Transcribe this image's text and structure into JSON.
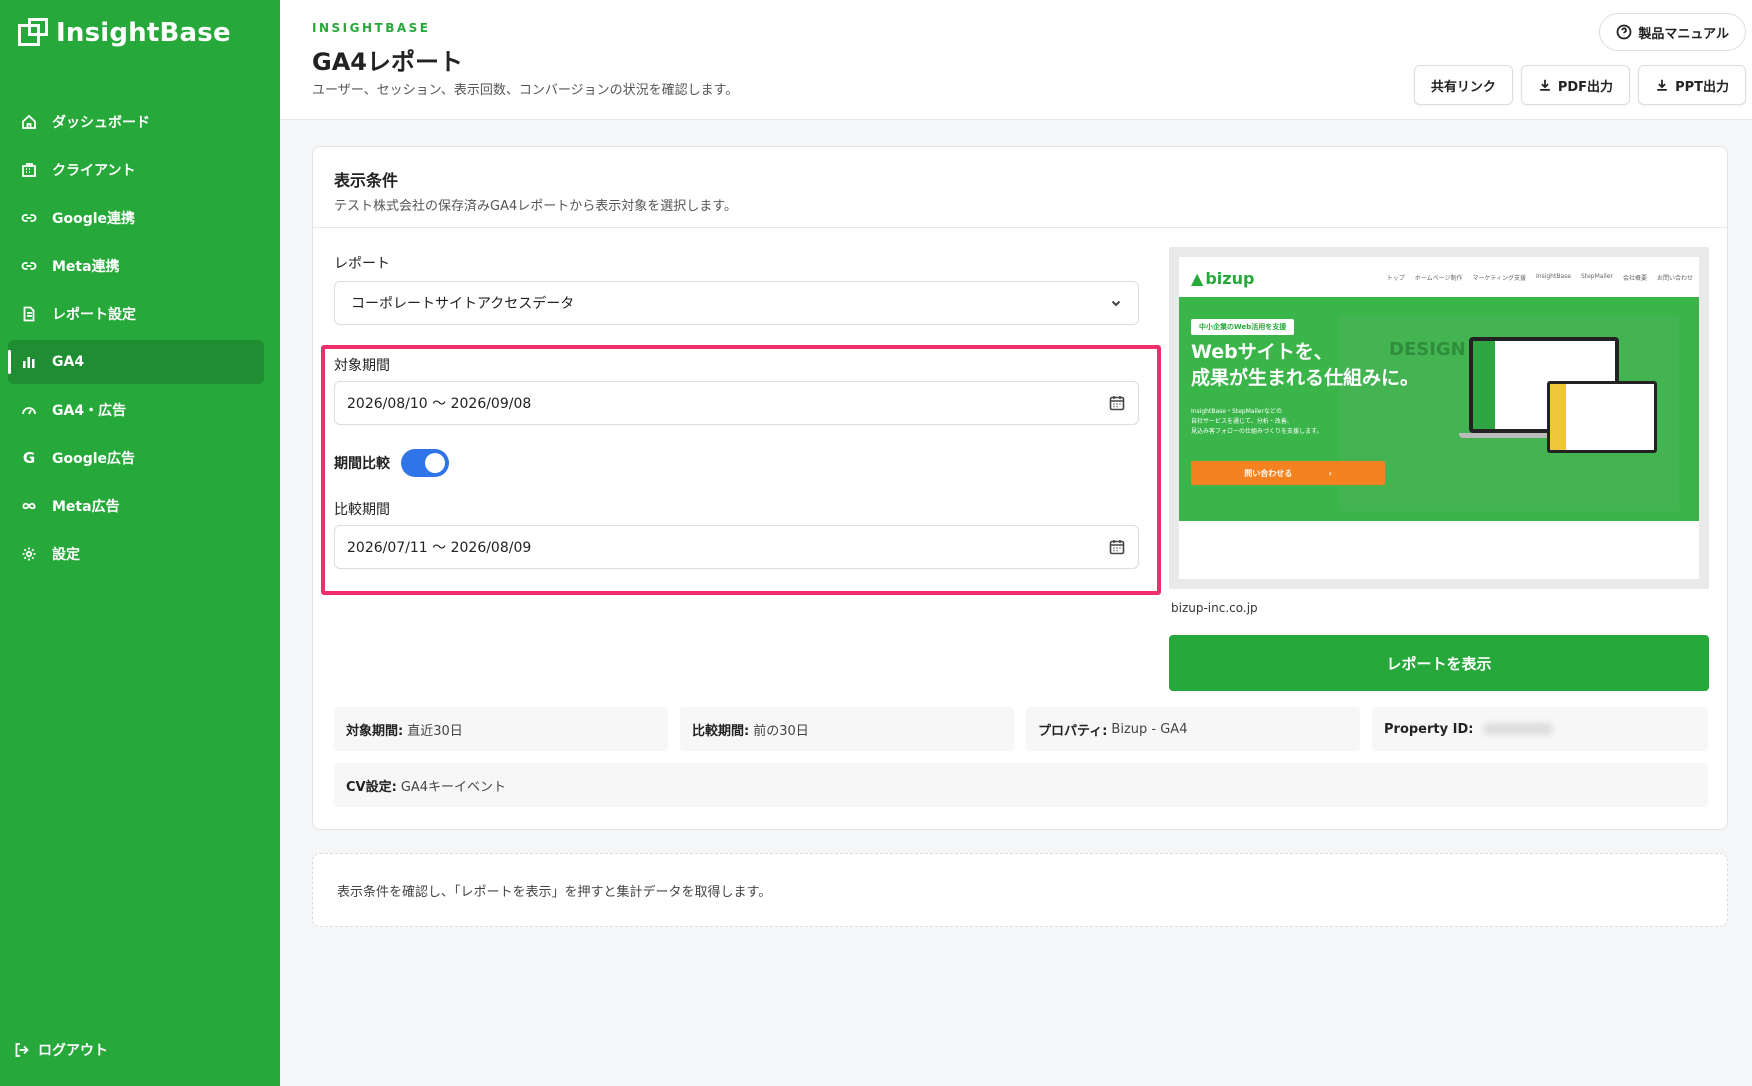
{
  "app": {
    "name": "InsightBase"
  },
  "sidebar": {
    "items": [
      {
        "label": "ダッシュボード",
        "icon": "home-icon"
      },
      {
        "label": "クライアント",
        "icon": "building-icon"
      },
      {
        "label": "Google連携",
        "icon": "link-icon"
      },
      {
        "label": "Meta連携",
        "icon": "link-icon"
      },
      {
        "label": "レポート設定",
        "icon": "document-icon"
      },
      {
        "label": "GA4",
        "icon": "bar-chart-icon",
        "active": true
      },
      {
        "label": "GA4・広告",
        "icon": "gauge-icon"
      },
      {
        "label": "Google広告",
        "icon": "google-icon"
      },
      {
        "label": "Meta広告",
        "icon": "infinity-icon"
      },
      {
        "label": "設定",
        "icon": "gear-icon"
      }
    ],
    "logout_label": "ログアウト"
  },
  "header": {
    "eyebrow": "INSIGHTBASE",
    "title": "GA4レポート",
    "subtitle": "ユーザー、セッション、表示回数、コンバージョンの状況を確認します。",
    "manual_label": "製品マニュアル",
    "share_label": "共有リンク",
    "pdf_label": "PDF出力",
    "ppt_label": "PPT出力"
  },
  "conditions": {
    "title": "表示条件",
    "description": "テスト株式会社の保存済みGA4レポートから表示対象を選択します。",
    "report_label": "レポート",
    "report_value": "コーポレートサイトアクセスデータ",
    "period_label": "対象期間",
    "period_value": "2026/08/10 〜 2026/09/08",
    "compare_toggle_label": "期間比較",
    "compare_enabled": true,
    "compare_period_label": "比較期間",
    "compare_period_value": "2026/07/11 〜 2026/08/09",
    "highlight_color": "#ef2e6b"
  },
  "preview": {
    "logo": "bizup",
    "nav_links": [
      "トップ",
      "ホームページ制作",
      "マーケティング支援",
      "InsightBase",
      "StepMailer",
      "会社概要",
      "お問い合わせ"
    ],
    "badge": "中小企業のWeb活用を支援",
    "headline": "Webサイトを、\n成果が生まれる仕組みに。",
    "design_text": "DESIGN",
    "body": "InsightBase・StepMailerなどの\n自社サービスを通じて、分析・改善、\n見込み客フォローの仕組みづくりを支援します。",
    "cta": "問い合わせる",
    "url": "bizup-inc.co.jp"
  },
  "show_report_label": "レポートを表示",
  "summary": {
    "period": {
      "label": "対象期間:",
      "value": "直近30日"
    },
    "compare": {
      "label": "比較期間:",
      "value": "前の30日"
    },
    "property": {
      "label": "プロパティ:",
      "value": "Bizup - GA4"
    },
    "property_id": {
      "label": "Property ID:",
      "value": ""
    },
    "cv": {
      "label": "CV設定:",
      "value": "GA4キーイベント"
    }
  },
  "info_text": "表示条件を確認し、「レポートを表示」を押すと集計データを取得します。",
  "colors": {
    "brand": "#26a93a",
    "toggle": "#2f74e8",
    "cta_orange": "#f58220"
  }
}
